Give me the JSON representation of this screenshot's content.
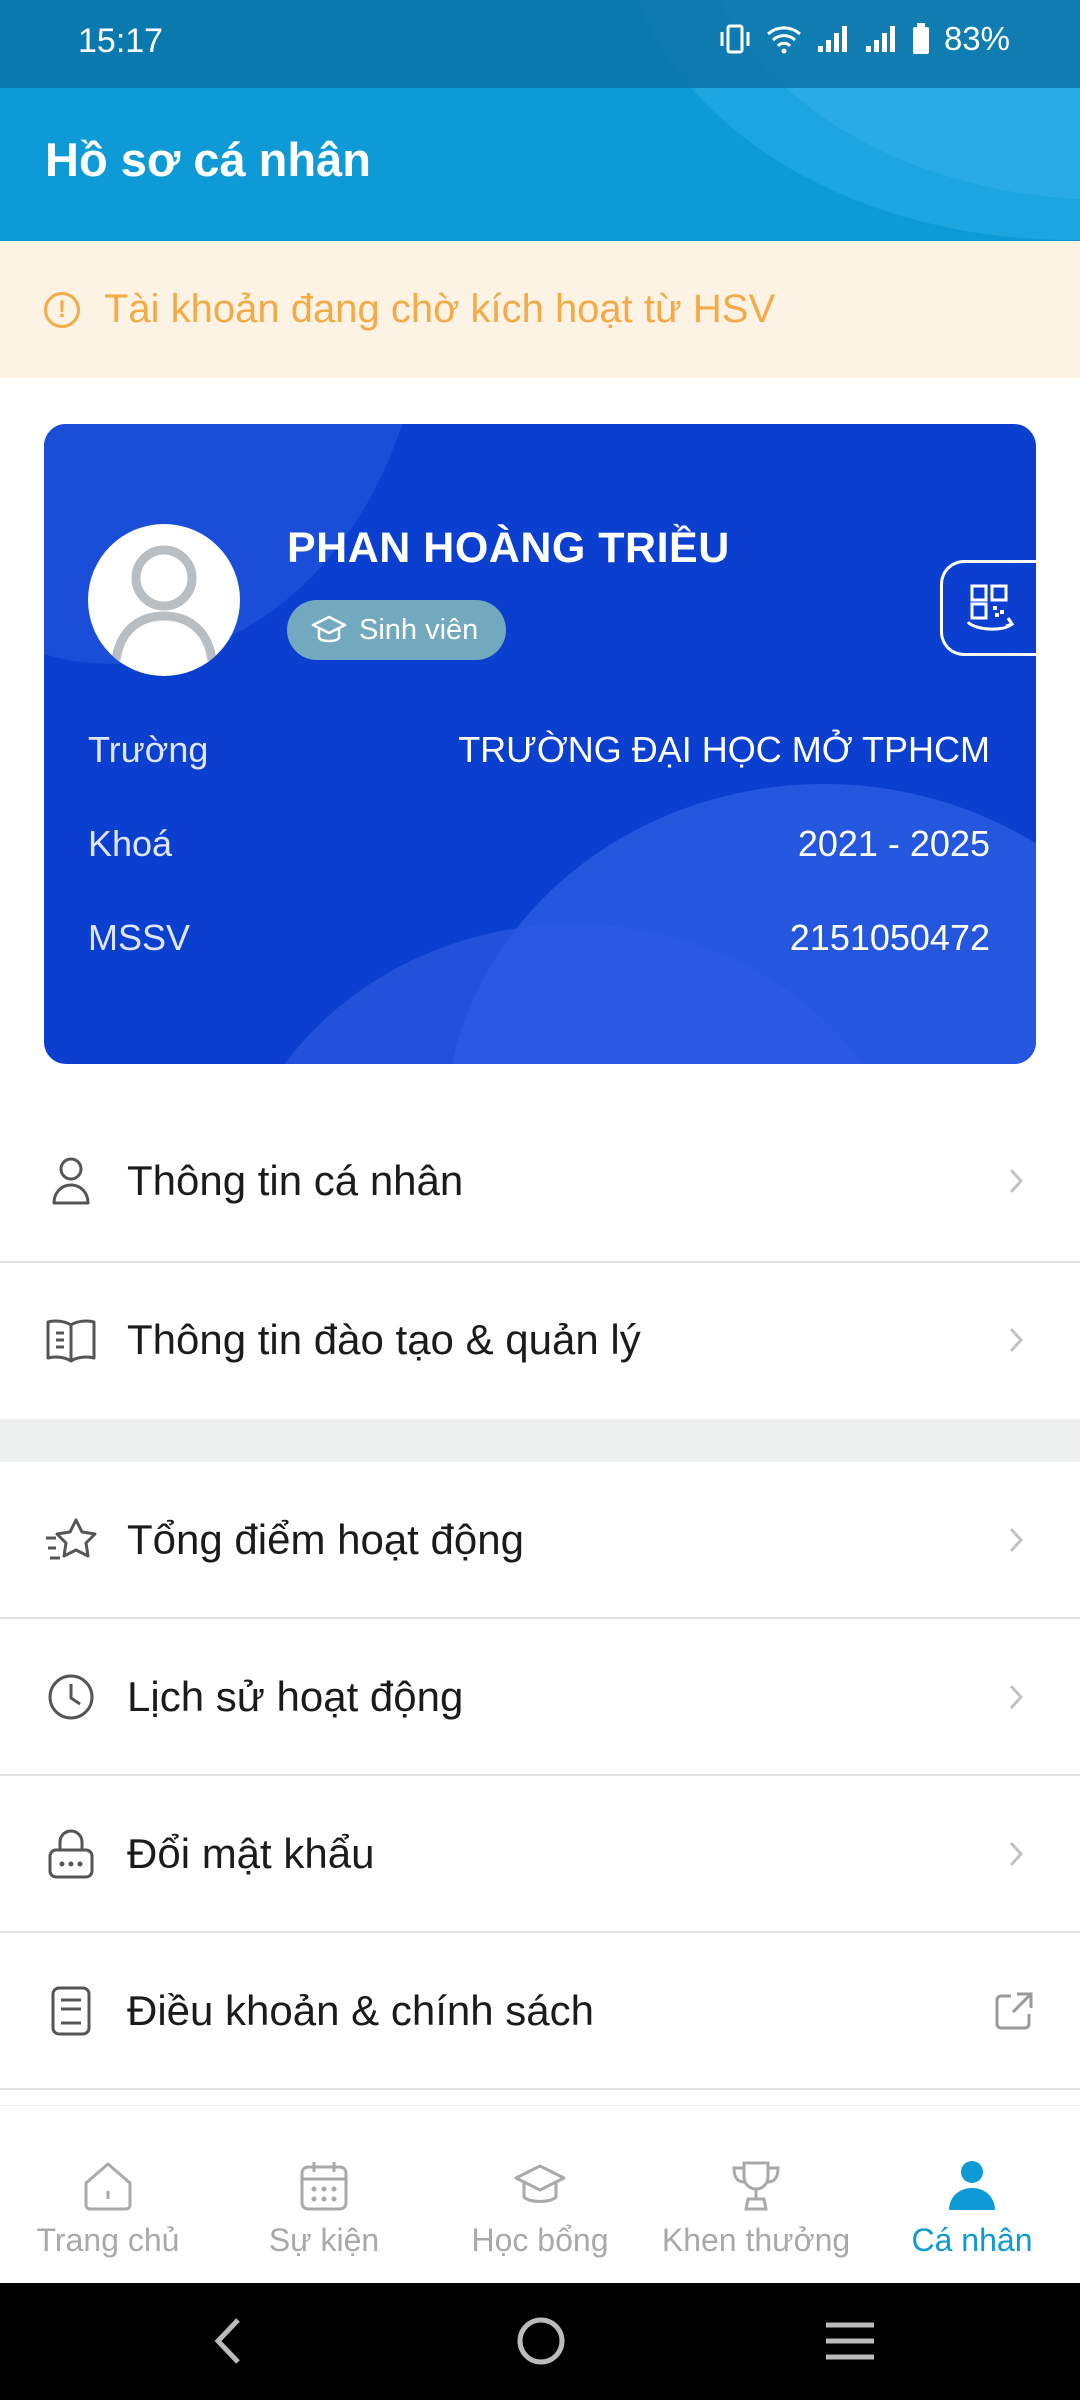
{
  "status_bar": {
    "time": "15:17",
    "battery": "83%"
  },
  "header": {
    "title": "Hồ sơ cá nhân"
  },
  "banner": {
    "text": "Tài khoản đang chờ kích hoạt từ HSV",
    "icon": "alert-circle-icon"
  },
  "card": {
    "name": "PHAN HOÀNG TRIỀU",
    "role": "Sinh viên",
    "rows": [
      {
        "label": "Trường",
        "value": "TRƯỜNG ĐẠI HỌC MỞ TPHCM"
      },
      {
        "label": "Khoá",
        "value": "2021 - 2025"
      },
      {
        "label": "MSSV",
        "value": "2151050472"
      }
    ],
    "colors": {
      "card_bg": "#0b3fd0",
      "role_badge": "#72a9bf"
    }
  },
  "menu_group1": [
    {
      "label": "Thông tin cá nhân",
      "icon": "user-icon",
      "action": "chevron"
    },
    {
      "label": "Thông tin đào tạo & quản lý",
      "icon": "book-icon",
      "action": "chevron"
    }
  ],
  "menu_group2": [
    {
      "label": "Tổng điểm hoạt động",
      "icon": "star-icon",
      "action": "chevron"
    },
    {
      "label": "Lịch sử hoạt động",
      "icon": "clock-icon",
      "action": "chevron"
    },
    {
      "label": "Đổi mật khẩu",
      "icon": "lock-icon",
      "action": "chevron"
    },
    {
      "label": "Điều khoản & chính sách",
      "icon": "document-icon",
      "action": "external-link"
    }
  ],
  "bottom_nav": [
    {
      "label": "Trang chủ",
      "icon": "home-icon",
      "active": false
    },
    {
      "label": "Sự kiện",
      "icon": "calendar-icon",
      "active": false
    },
    {
      "label": "Học bổng",
      "icon": "graduation-cap-icon",
      "active": false
    },
    {
      "label": "Khen thưởng",
      "icon": "trophy-icon",
      "active": false
    },
    {
      "label": "Cá nhân",
      "icon": "person-icon",
      "active": true
    }
  ],
  "colors": {
    "accent": "#0e9ad6",
    "warning": "#f3aa47",
    "inactive_nav": "#a7a9ab"
  }
}
